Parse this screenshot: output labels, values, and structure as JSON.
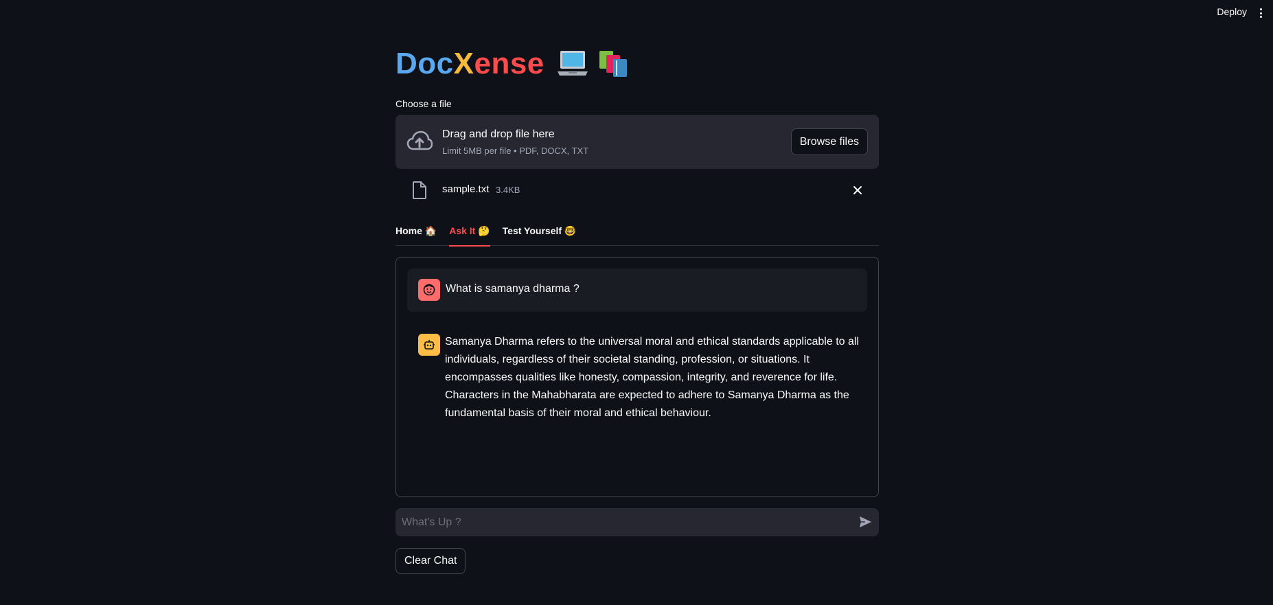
{
  "header": {
    "deploy_label": "Deploy"
  },
  "title": {
    "part1": "Doc",
    "part2": "X",
    "part3": "ense",
    "icons": [
      "laptop-icon",
      "books-icon"
    ]
  },
  "uploader": {
    "label": "Choose a file",
    "drop_title": "Drag and drop file here",
    "drop_sub": "Limit 5MB per file • PDF, DOCX, TXT",
    "browse_label": "Browse files"
  },
  "file": {
    "name": "sample.txt",
    "size": "3.4KB"
  },
  "tabs": [
    {
      "label": "Home 🏠",
      "active": false
    },
    {
      "label": "Ask It 🤔",
      "active": true
    },
    {
      "label": "Test Yourself 🤓",
      "active": false
    }
  ],
  "chat": {
    "user_message": "What is samanya dharma ?",
    "bot_message": "Samanya Dharma refers to the universal moral and ethical standards applicable to all individuals, regardless of their societal standing, profession, or situations. It encompasses qualities like honesty, compassion, integrity, and reverence for life. Characters in the Mahabharata are expected to adhere to Samanya Dharma as the fundamental basis of their moral and ethical behaviour."
  },
  "input": {
    "placeholder": "What's Up ?"
  },
  "clear_label": "Clear Chat",
  "colors": {
    "background": "#0e1117",
    "accent": "#ff4b4b",
    "title_blue": "#5aa9f0",
    "title_yellow": "#f6b93b"
  }
}
